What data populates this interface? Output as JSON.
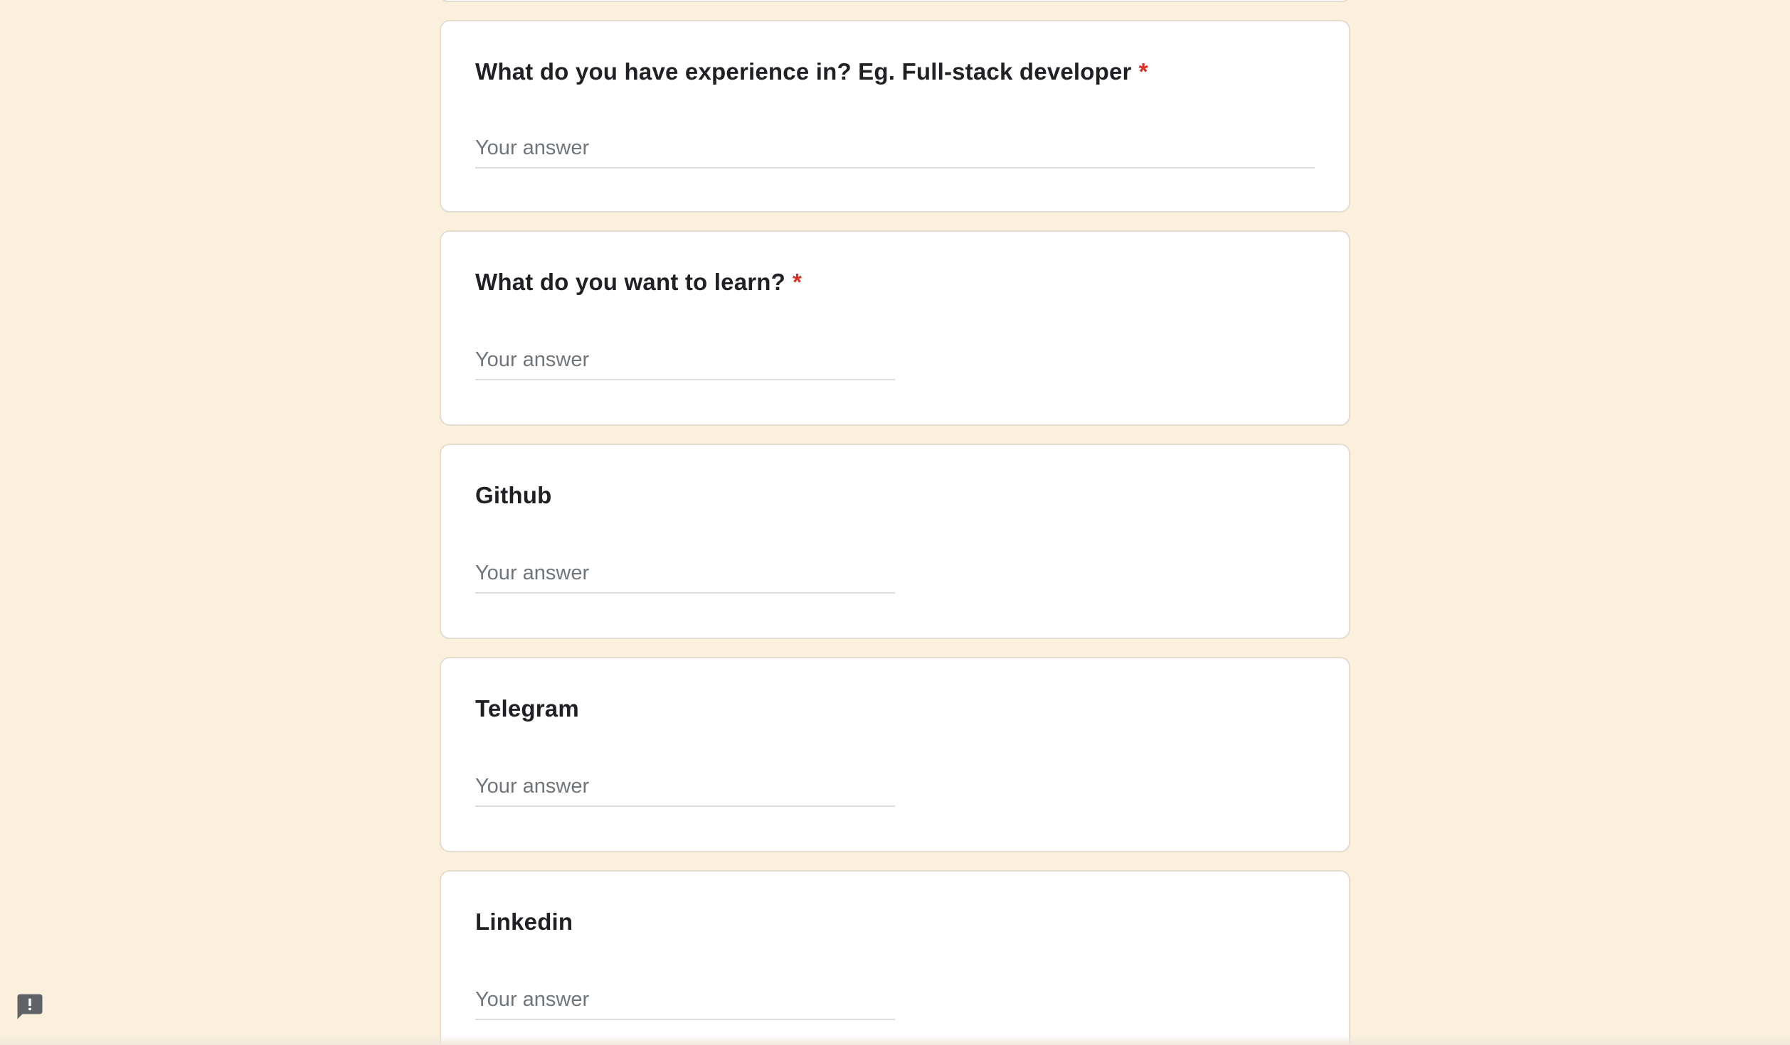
{
  "questions": [
    {
      "title": "What do you have experience in? Eg. Full-stack developer",
      "required_mark": "*",
      "placeholder": "Your answer"
    },
    {
      "title": "What do you want to learn?",
      "required_mark": "*",
      "placeholder": "Your answer"
    },
    {
      "title": "Github",
      "placeholder": "Your answer"
    },
    {
      "title": "Telegram",
      "placeholder": "Your answer"
    },
    {
      "title": "Linkedin",
      "placeholder": "Your answer"
    }
  ],
  "feedback_icon": "report-feedback-icon",
  "colors": {
    "background": "#fbf0dc",
    "card": "#ffffff",
    "required": "#d93025",
    "text": "#202124",
    "placeholder": "#70757a"
  }
}
